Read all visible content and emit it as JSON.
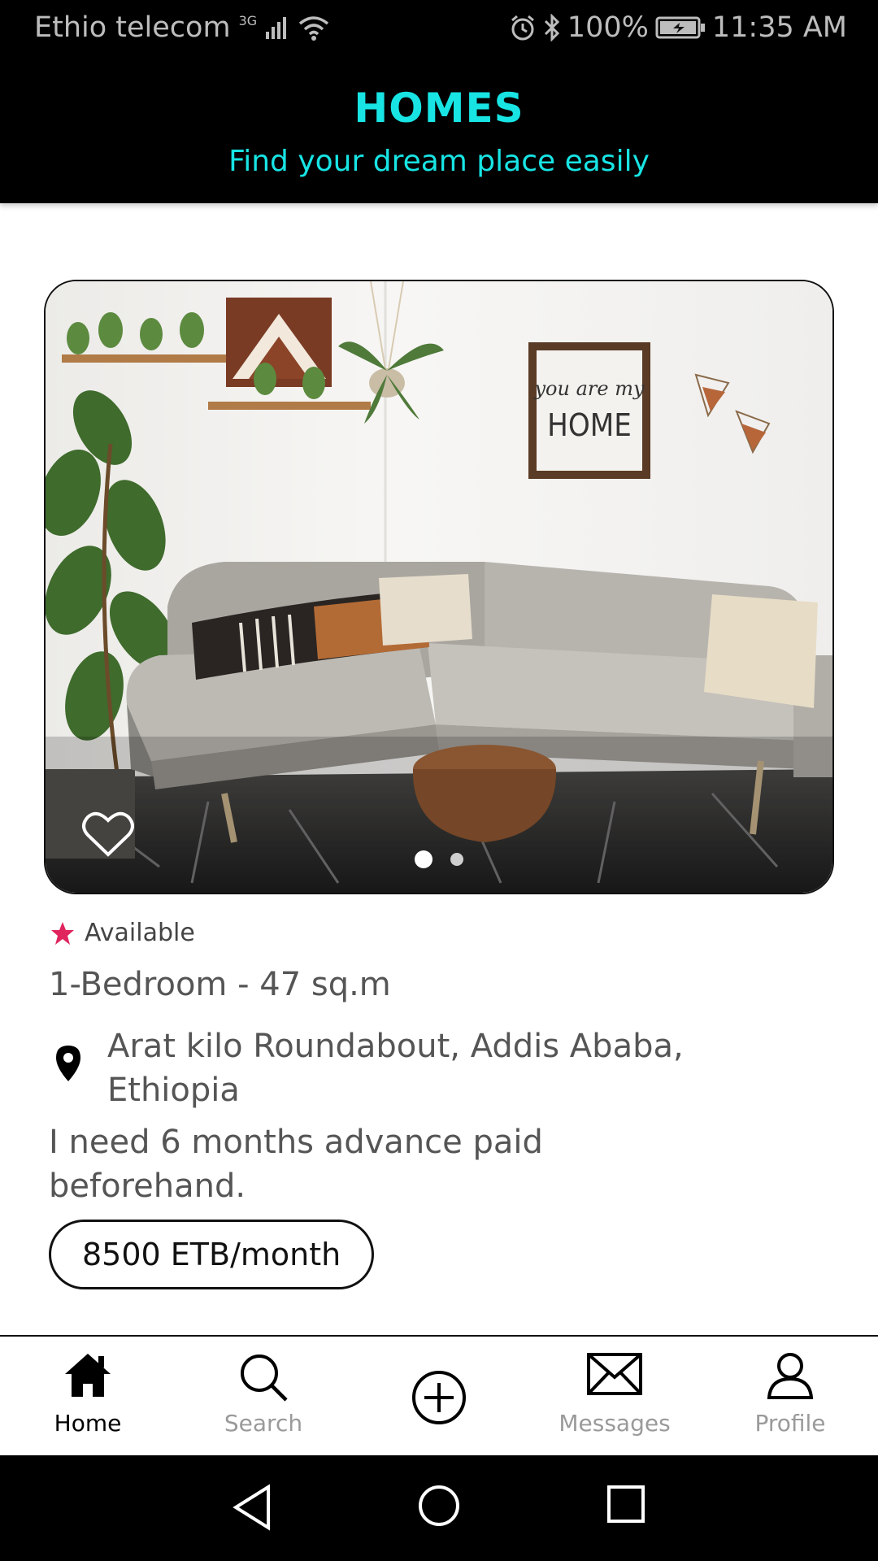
{
  "status_bar": {
    "carrier": "Ethio telecom",
    "network": "3G",
    "battery": "100%",
    "time": "11:35 AM"
  },
  "header": {
    "title": "HOMES",
    "subtitle": "Find your dream place easily"
  },
  "listing": {
    "image_frame_text_line1": "you are my",
    "image_frame_text_line2": "HOME",
    "carousel": {
      "total": 2,
      "active": 1
    },
    "availability": "Available",
    "details": "1-Bedroom - 47 sq.m",
    "address": "Arat kilo Roundabout, Addis Ababa, Ethiopia",
    "note": "I need 6 months advance paid beforehand.",
    "price_amount": "8500 ETB",
    "price_unit": "/month"
  },
  "bottom_nav": {
    "home": "Home",
    "search": "Search",
    "messages": "Messages",
    "profile": "Profile"
  },
  "colors": {
    "accent": "#18e4e4",
    "star": "#e0245e",
    "header_bg": "#000000"
  },
  "icons": {
    "favorite": "heart-outline-icon",
    "availability": "star-icon",
    "location": "location-pin-icon",
    "nav_home": "home-icon",
    "nav_search": "search-icon",
    "nav_add": "add-circle-icon",
    "nav_messages": "envelope-icon",
    "nav_profile": "user-icon"
  }
}
